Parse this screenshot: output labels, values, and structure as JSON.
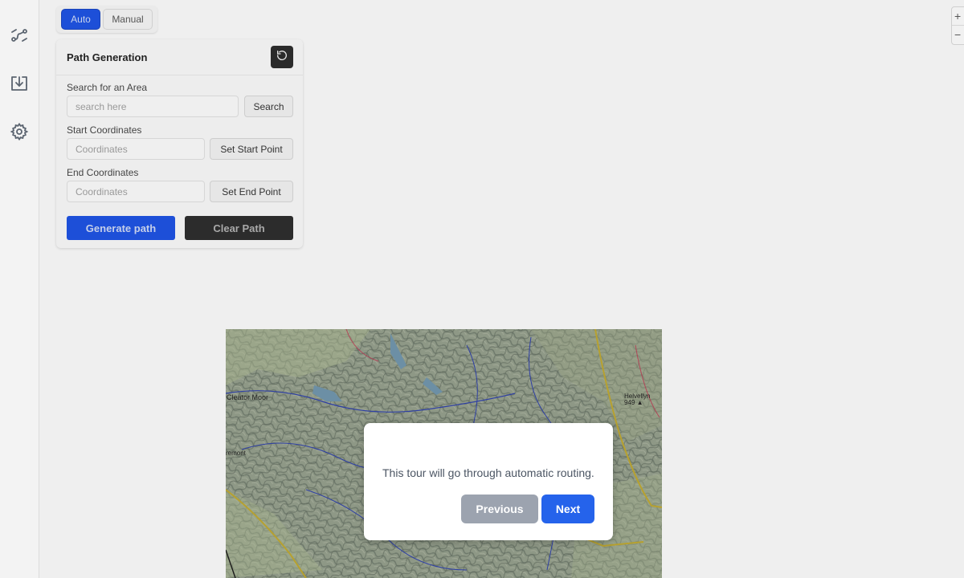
{
  "mode_toggle": {
    "auto_label": "Auto",
    "manual_label": "Manual"
  },
  "sidebar": {
    "items": [
      {
        "icon": "route-icon"
      },
      {
        "icon": "download-icon"
      },
      {
        "icon": "gear-icon"
      }
    ]
  },
  "zoom": {
    "in_label": "+",
    "out_label": "−"
  },
  "panel": {
    "title": "Path Generation",
    "search": {
      "label": "Search for an Area",
      "placeholder": "search here",
      "button": "Search"
    },
    "start": {
      "label": "Start Coordinates",
      "placeholder": "Coordinates",
      "button": "Set Start Point"
    },
    "end": {
      "label": "End Coordinates",
      "placeholder": "Coordinates",
      "button": "Set End Point"
    },
    "generate_label": "Generate path",
    "clear_label": "Clear Path"
  },
  "map": {
    "places": [
      "Cleator Moor",
      "remont",
      "Helvellyn\n949 ▲"
    ]
  },
  "tour": {
    "text": "This tour will go through automatic routing.",
    "previous_label": "Previous",
    "next_label": "Next"
  },
  "colors": {
    "primary": "#2563eb",
    "secondary": "#9ca3af",
    "dark": "#2c2c2c"
  }
}
